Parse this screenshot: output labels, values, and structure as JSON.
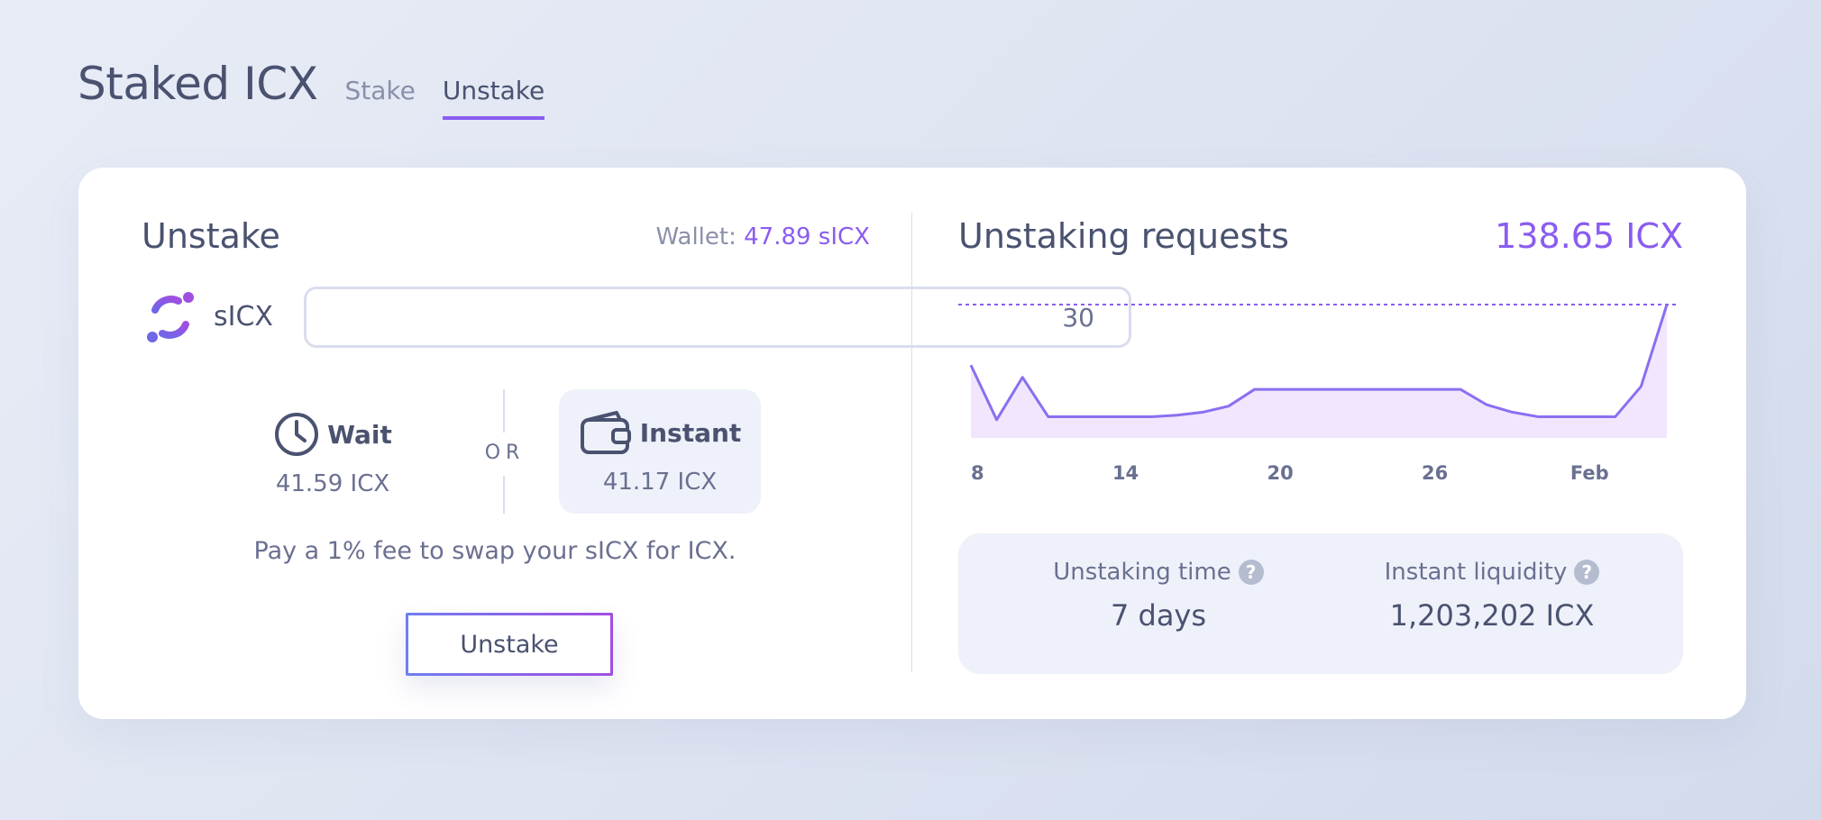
{
  "header": {
    "title": "Staked ICX",
    "tabs": [
      {
        "label": "Stake",
        "active": false
      },
      {
        "label": "Unstake",
        "active": true
      }
    ]
  },
  "unstake": {
    "title": "Unstake",
    "wallet_label": "Wallet:",
    "wallet_value": "47.89 sICX",
    "token_label": "sICX",
    "amount": "30",
    "options": {
      "wait": {
        "label": "Wait",
        "value": "41.59 ICX",
        "icon": "clock-icon"
      },
      "or": "OR",
      "instant": {
        "label": "Instant",
        "value": "41.17 ICX",
        "icon": "wallet-icon",
        "selected": true
      }
    },
    "fee_note": "Pay a 1% fee to swap your sICX for ICX.",
    "button_label": "Unstake"
  },
  "requests": {
    "title": "Unstaking requests",
    "total": "138.65 ICX",
    "stats": [
      {
        "label": "Unstaking time",
        "value": "7 days"
      },
      {
        "label": "Instant liquidity",
        "value": "1,203,202 ICX"
      }
    ]
  },
  "chart_data": {
    "type": "area",
    "x_tick_labels": [
      "8",
      "14",
      "20",
      "26",
      "Feb"
    ],
    "series": [
      {
        "values": [
          48,
          12,
          40,
          14,
          14,
          14,
          14,
          14,
          15,
          17,
          21,
          32,
          32,
          32,
          32,
          32,
          32,
          32,
          32,
          32,
          22,
          17,
          14,
          14,
          14,
          14,
          34,
          88
        ]
      }
    ],
    "ylim": [
      0,
      88
    ],
    "reference_line": 88,
    "grid": false,
    "colors": {
      "line": "#8a6ff0",
      "fill": "#f1e6fd",
      "reference": "#8a5cf0"
    }
  },
  "colors": {
    "accent": "#8a5cf0",
    "text": "#4a5270",
    "muted": "#8a90aa",
    "panel": "#eef1f9"
  }
}
